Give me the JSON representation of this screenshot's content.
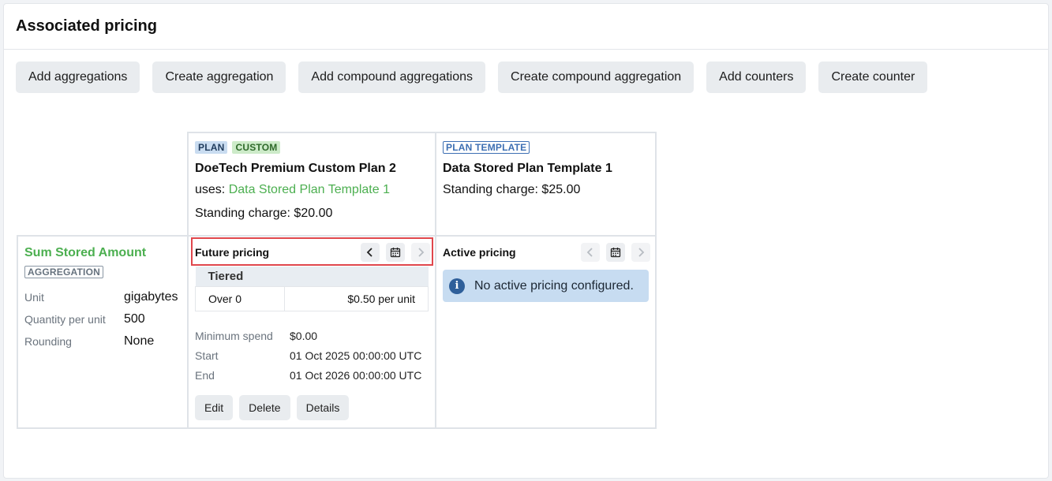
{
  "panel": {
    "title": "Associated pricing"
  },
  "toolbar": {
    "buttons": [
      "Add aggregations",
      "Create aggregation",
      "Add compound aggregations",
      "Create compound aggregation",
      "Add counters",
      "Create counter"
    ]
  },
  "plans": [
    {
      "badges": [
        "PLAN",
        "CUSTOM"
      ],
      "name": "DoeTech Premium Custom Plan 2",
      "uses_prefix": "uses: ",
      "uses_link": "Data Stored Plan Template 1",
      "standing_charge": "Standing charge: $20.00"
    },
    {
      "badges": [
        "PLAN TEMPLATE"
      ],
      "name": "Data Stored Plan Template 1",
      "standing_charge": "Standing charge: $25.00"
    }
  ],
  "aggregation": {
    "title": "Sum Stored Amount",
    "badge": "AGGREGATION",
    "fields": [
      {
        "label": "Unit",
        "value": "gigabytes"
      },
      {
        "label": "Quantity per unit",
        "value": "500"
      },
      {
        "label": "Rounding",
        "value": "None"
      }
    ]
  },
  "future_pricing": {
    "title": "Future pricing",
    "table_header": "Tiered",
    "tier_label": "Over 0",
    "tier_price": "$0.50 per unit",
    "meta": [
      {
        "label": "Minimum spend",
        "value": "$0.00"
      },
      {
        "label": "Start",
        "value": "01 Oct 2025 00:00:00 UTC"
      },
      {
        "label": "End",
        "value": "01 Oct 2026 00:00:00 UTC"
      }
    ],
    "actions": [
      "Edit",
      "Delete",
      "Details"
    ]
  },
  "active_pricing": {
    "title": "Active pricing",
    "alert": "No active pricing configured."
  },
  "icons": {
    "prev": "chevron-left-icon",
    "calendar": "calendar-icon",
    "next": "chevron-right-icon",
    "info": "info-icon"
  },
  "colors": {
    "green": "#4caf50",
    "highlight": "#e0474c",
    "info_bg": "#c7dcf1"
  }
}
